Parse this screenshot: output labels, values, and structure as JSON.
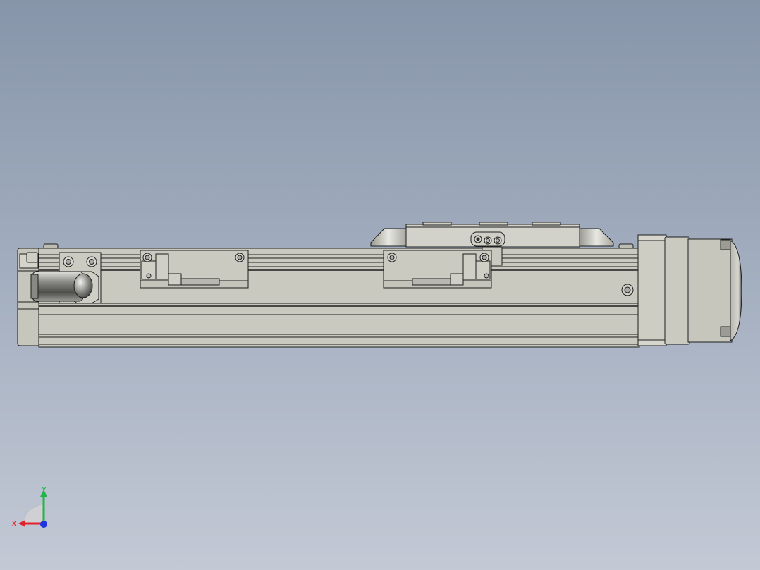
{
  "viewport": {
    "background_top": "#8795aa",
    "background_bottom": "#c3c9d5"
  },
  "model": {
    "name": "linear-actuator-with-motor",
    "body_color": "#c9c9bf",
    "edge_color": "#1e1e1e",
    "slider_color": "#d2d2ca"
  },
  "triad": {
    "x_label": "X",
    "y_label": "Y",
    "x_color": "#e0202a",
    "y_color": "#22b44a",
    "z_color": "#2233dd"
  }
}
